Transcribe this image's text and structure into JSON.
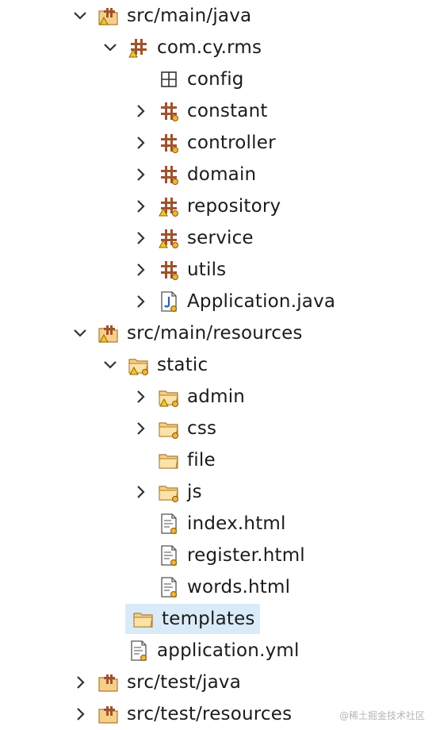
{
  "tree": {
    "items": [
      {
        "label": "src/main/java",
        "icon": "source-folder-warning-icon",
        "expander": "expanded"
      },
      {
        "label": "com.cy.rms",
        "icon": "package-warning-icon",
        "expander": "expanded"
      },
      {
        "label": "config",
        "icon": "empty-package-icon",
        "expander": "none"
      },
      {
        "label": "constant",
        "icon": "package-icon",
        "expander": "collapsed"
      },
      {
        "label": "controller",
        "icon": "package-icon",
        "expander": "collapsed"
      },
      {
        "label": "domain",
        "icon": "package-icon",
        "expander": "collapsed"
      },
      {
        "label": "repository",
        "icon": "package-warning-icon",
        "expander": "collapsed"
      },
      {
        "label": "service",
        "icon": "package-warning-icon",
        "expander": "collapsed"
      },
      {
        "label": "utils",
        "icon": "package-icon",
        "expander": "collapsed"
      },
      {
        "label": "Application.java",
        "icon": "java-file-icon",
        "expander": "collapsed"
      },
      {
        "label": "src/main/resources",
        "icon": "source-folder-warning-icon",
        "expander": "expanded"
      },
      {
        "label": "static",
        "icon": "folder-warning-icon",
        "expander": "expanded"
      },
      {
        "label": "admin",
        "icon": "folder-warning-icon",
        "expander": "collapsed"
      },
      {
        "label": "css",
        "icon": "folder-icon",
        "expander": "collapsed"
      },
      {
        "label": "file",
        "icon": "folder-icon",
        "expander": "none"
      },
      {
        "label": "js",
        "icon": "folder-icon",
        "expander": "collapsed"
      },
      {
        "label": "index.html",
        "icon": "html-file-icon",
        "expander": "none"
      },
      {
        "label": "register.html",
        "icon": "html-file-icon",
        "expander": "none"
      },
      {
        "label": "words.html",
        "icon": "html-file-icon",
        "expander": "none"
      },
      {
        "label": "templates",
        "icon": "folder-open-icon",
        "expander": "none",
        "selected": true
      },
      {
        "label": "application.yml",
        "icon": "text-file-icon",
        "expander": "none"
      },
      {
        "label": "src/test/java",
        "icon": "source-folder-icon",
        "expander": "collapsed"
      },
      {
        "label": "src/test/resources",
        "icon": "source-folder-icon",
        "expander": "collapsed"
      }
    ]
  },
  "watermark": "@稀土掘金技术社区",
  "colors": {
    "selection": "#d9ebf9",
    "package_brown": "#a0522d",
    "folder_yellow": "#f3c26b",
    "warning_yellow": "#f4c430"
  }
}
